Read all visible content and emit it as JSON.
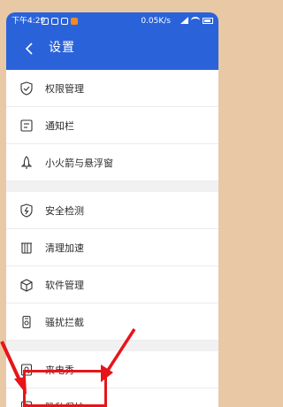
{
  "status_bar": {
    "time": "下午4:29",
    "speed": "0.05K/s"
  },
  "header": {
    "title": "设置"
  },
  "menu": {
    "items": [
      {
        "label": "权限管理",
        "icon": "shield-check-icon"
      },
      {
        "label": "通知栏",
        "icon": "notification-bar-icon"
      },
      {
        "label": "小火箭与悬浮窗",
        "icon": "rocket-icon"
      },
      {
        "label": "安全检测",
        "icon": "shield-lightning-icon"
      },
      {
        "label": "清理加速",
        "icon": "clean-icon"
      },
      {
        "label": "软件管理",
        "icon": "software-box-icon"
      },
      {
        "label": "骚扰拦截",
        "icon": "phone-block-icon"
      },
      {
        "label": "来电秀",
        "icon": "caller-show-icon"
      },
      {
        "label": "隐私保护",
        "icon": "privacy-icon"
      }
    ]
  },
  "colors": {
    "header_bg": "#2a63d9",
    "highlight": "#e7141a",
    "frame": "#e9c8a6"
  }
}
